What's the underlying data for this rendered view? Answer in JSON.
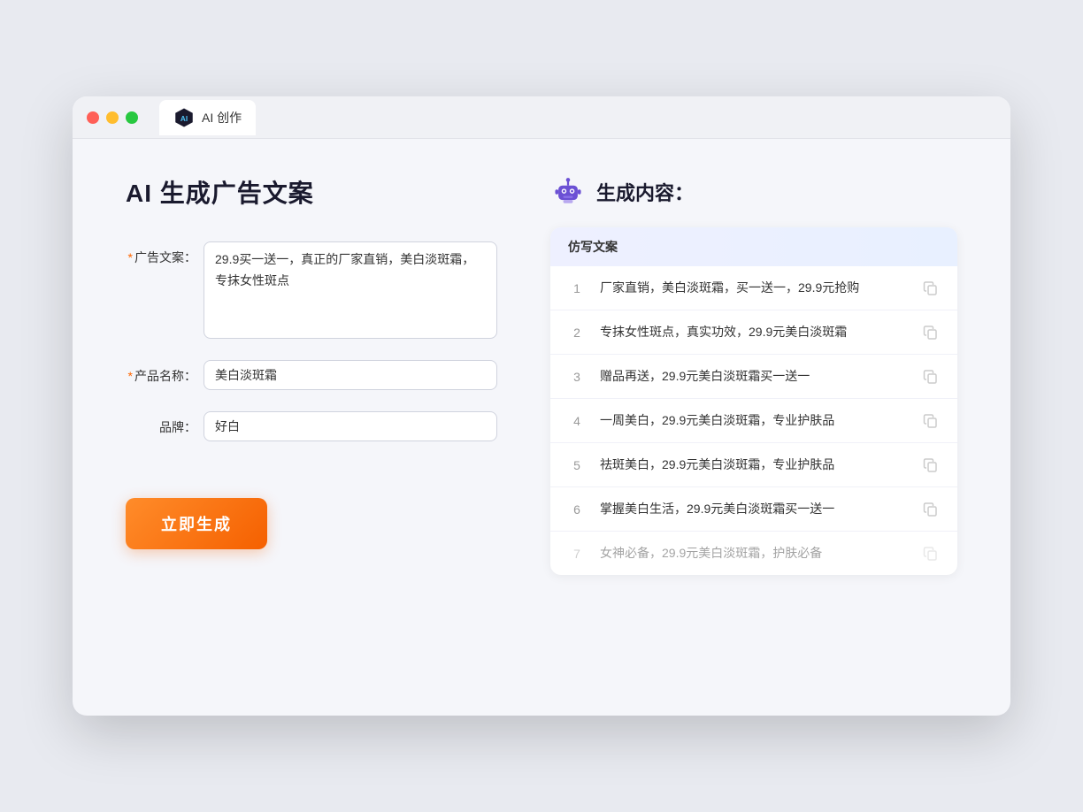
{
  "browser": {
    "tab_label": "AI 创作"
  },
  "page": {
    "title": "AI 生成广告文案",
    "result_title": "生成内容："
  },
  "form": {
    "ad_copy_label": "广告文案：",
    "ad_copy_required": true,
    "ad_copy_value": "29.9买一送一，真正的厂家直销，美白淡斑霜，专抹女性斑点",
    "product_name_label": "产品名称：",
    "product_name_required": true,
    "product_name_value": "美白淡斑霜",
    "brand_label": "品牌：",
    "brand_required": false,
    "brand_value": "好白",
    "generate_button": "立即生成"
  },
  "results": {
    "column_header": "仿写文案",
    "items": [
      {
        "id": 1,
        "text": "厂家直销，美白淡斑霜，买一送一，29.9元抢购",
        "faded": false
      },
      {
        "id": 2,
        "text": "专抹女性斑点，真实功效，29.9元美白淡斑霜",
        "faded": false
      },
      {
        "id": 3,
        "text": "赠品再送，29.9元美白淡斑霜买一送一",
        "faded": false
      },
      {
        "id": 4,
        "text": "一周美白，29.9元美白淡斑霜，专业护肤品",
        "faded": false
      },
      {
        "id": 5,
        "text": "祛斑美白，29.9元美白淡斑霜，专业护肤品",
        "faded": false
      },
      {
        "id": 6,
        "text": "掌握美白生活，29.9元美白淡斑霜买一送一",
        "faded": false
      },
      {
        "id": 7,
        "text": "女神必备，29.9元美白淡斑霜，护肤必备",
        "faded": true
      }
    ]
  }
}
